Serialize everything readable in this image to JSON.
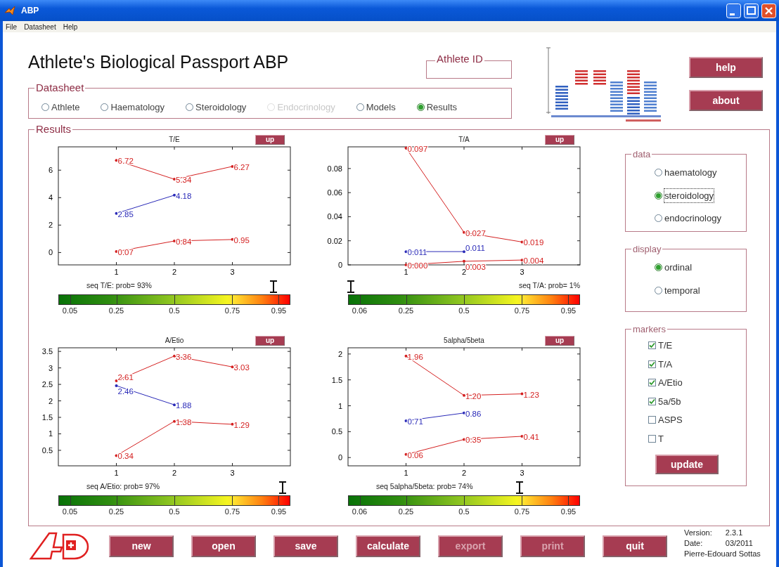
{
  "window": {
    "title": "ABP"
  },
  "menu": [
    {
      "label": "File"
    },
    {
      "label": "Datasheet"
    },
    {
      "label": "Help"
    }
  ],
  "header": {
    "title": "Athlete's Biological Passport ABP",
    "athlete_id": {
      "legend": "Athlete ID"
    }
  },
  "datasheet": {
    "legend": "Datasheet",
    "options": [
      {
        "label": "Athlete",
        "selected": false,
        "disabled": false
      },
      {
        "label": "Haematology",
        "selected": false,
        "disabled": false
      },
      {
        "label": "Steroidology",
        "selected": false,
        "disabled": false
      },
      {
        "label": "Endocrinology",
        "selected": false,
        "disabled": true
      },
      {
        "label": "Models",
        "selected": false,
        "disabled": false
      },
      {
        "label": "Results",
        "selected": true,
        "disabled": false
      }
    ]
  },
  "side_buttons": [
    {
      "label": "help"
    },
    {
      "label": "about"
    }
  ],
  "results": {
    "legend": "Results",
    "charts": [
      {
        "up_button": "up",
        "caption": "seq T/E: prob= 93%",
        "marker": {
          "level": 0.93
        },
        "chart_data": {
          "type": "line",
          "title": "T/E",
          "x": [
            1,
            2,
            3
          ],
          "xlim": [
            0,
            4
          ],
          "ylim": [
            -0.9,
            7.7
          ],
          "xticks": [
            1,
            2,
            3
          ],
          "yticks": [
            0,
            2,
            4,
            6
          ],
          "series": [
            {
              "color": "#d42020",
              "values": [
                6.72,
                5.34,
                6.27
              ],
              "value_labels": [
                "6.72",
                "5.34",
                "6.27"
              ]
            },
            {
              "color": "#2a2ab8",
              "values": [
                2.85,
                4.18,
                null
              ],
              "value_labels": [
                "2.85",
                "4.18",
                null
              ]
            },
            {
              "color": "#d42020",
              "values": [
                0.07,
                0.84,
                0.95
              ],
              "value_labels": [
                "0.07",
                "0.84",
                "0.95"
              ]
            }
          ]
        },
        "scale_ticks": [
          "0.05",
          "0.25",
          "0.5",
          "0.75",
          "0.95"
        ]
      },
      {
        "up_button": "up",
        "caption": "seq T/A: prob= 1%",
        "marker": {
          "level": 0.01
        },
        "chart_data": {
          "type": "line",
          "title": "T/A",
          "x": [
            1,
            2,
            3
          ],
          "xlim": [
            0,
            4
          ],
          "ylim": [
            0,
            0.098
          ],
          "xticks": [
            1,
            2,
            3
          ],
          "yticks": [
            0,
            0.02,
            0.04,
            0.06,
            0.08
          ],
          "series": [
            {
              "color": "#d42020",
              "values": [
                0.097,
                0.027,
                0.019
              ],
              "value_labels": [
                "0.097",
                "0.027",
                "0.019"
              ]
            },
            {
              "color": "#2a2ab8",
              "values": [
                0.011,
                0.011,
                null
              ],
              "value_labels": [
                "0.011",
                "0.011",
                null
              ]
            },
            {
              "color": "#d42020",
              "values": [
                0,
                0.003,
                0.004
              ],
              "value_labels": [
                "0.000",
                "0.003",
                "0.004"
              ]
            }
          ]
        },
        "scale_ticks": [
          "0.06",
          "0.25",
          "0.5",
          "0.75",
          "0.95"
        ]
      },
      {
        "up_button": "up",
        "caption": "seq A/Etio: prob= 97%",
        "marker": {
          "level": 0.97
        },
        "chart_data": {
          "type": "line",
          "title": "A/Etio",
          "x": [
            1,
            2,
            3
          ],
          "xlim": [
            0,
            4
          ],
          "ylim": [
            0.03,
            3.61
          ],
          "xticks": [
            1,
            2,
            3
          ],
          "yticks": [
            0.5,
            1,
            1.5,
            2,
            2.5,
            3,
            3.5
          ],
          "series": [
            {
              "color": "#d42020",
              "values": [
                2.61,
                3.36,
                3.03
              ],
              "value_labels": [
                "2.61",
                "3.36",
                "3.03"
              ]
            },
            {
              "color": "#2a2ab8",
              "values": [
                2.46,
                1.88,
                null
              ],
              "value_labels": [
                "2.46",
                "1.88",
                null
              ]
            },
            {
              "color": "#d42020",
              "values": [
                0.34,
                1.38,
                1.29
              ],
              "value_labels": [
                "0.34",
                "1.38",
                "1.29"
              ]
            }
          ]
        },
        "scale_ticks": [
          "0.05",
          "0.25",
          "0.5",
          "0.75",
          "0.95"
        ]
      },
      {
        "up_button": "up",
        "caption": "seq 5alpha/5beta: prob= 74%",
        "marker": {
          "level": 0.74
        },
        "chart_data": {
          "type": "line",
          "title": "5alpha/5beta",
          "x": [
            1,
            2,
            3
          ],
          "xlim": [
            0,
            4
          ],
          "ylim": [
            -0.16,
            2.12
          ],
          "xticks": [
            1,
            2,
            3
          ],
          "yticks": [
            0,
            0.5,
            1,
            1.5,
            2
          ],
          "series": [
            {
              "color": "#d42020",
              "values": [
                1.96,
                1.2,
                1.23
              ],
              "value_labels": [
                "1.96",
                "1.20",
                "1.23"
              ]
            },
            {
              "color": "#2a2ab8",
              "values": [
                0.71,
                0.86,
                null
              ],
              "value_labels": [
                "0.71",
                "0.86",
                null
              ]
            },
            {
              "color": "#d42020",
              "values": [
                0.06,
                0.35,
                0.41
              ],
              "value_labels": [
                "0.06",
                "0.35",
                "0.41"
              ]
            }
          ]
        },
        "scale_ticks": [
          "0.06",
          "0.25",
          "0.5",
          "0.75",
          "0.95"
        ]
      }
    ],
    "data_panel": {
      "legend": "data",
      "options": [
        {
          "label": "haematology",
          "selected": false,
          "focused": false
        },
        {
          "label": "steroidology",
          "selected": true,
          "focused": true
        },
        {
          "label": "endocrinology",
          "selected": false,
          "focused": false
        }
      ]
    },
    "display_panel": {
      "legend": "display",
      "options": [
        {
          "label": "ordinal",
          "selected": true,
          "focused": false
        },
        {
          "label": "temporal",
          "selected": false,
          "focused": false
        }
      ]
    },
    "markers_panel": {
      "legend": "markers",
      "items": [
        {
          "label": "T/E",
          "checked": true
        },
        {
          "label": "T/A",
          "checked": true
        },
        {
          "label": "A/Etio",
          "checked": true
        },
        {
          "label": "5a/5b",
          "checked": true
        },
        {
          "label": "ASPS",
          "checked": false
        },
        {
          "label": "T",
          "checked": false
        }
      ],
      "button": {
        "label": "update"
      }
    }
  },
  "footer": {
    "buttons": [
      {
        "label": "new",
        "disabled": false
      },
      {
        "label": "open",
        "disabled": false
      },
      {
        "label": "save",
        "disabled": false
      },
      {
        "label": "calculate",
        "disabled": false
      },
      {
        "label": "export",
        "disabled": true
      },
      {
        "label": "print",
        "disabled": true
      },
      {
        "label": "quit",
        "disabled": false
      }
    ],
    "version_label": "Version:",
    "version": "2.3.1",
    "date_label": "Date:",
    "date": "03/2011",
    "author": "Pierre-Edouard Sottas"
  }
}
